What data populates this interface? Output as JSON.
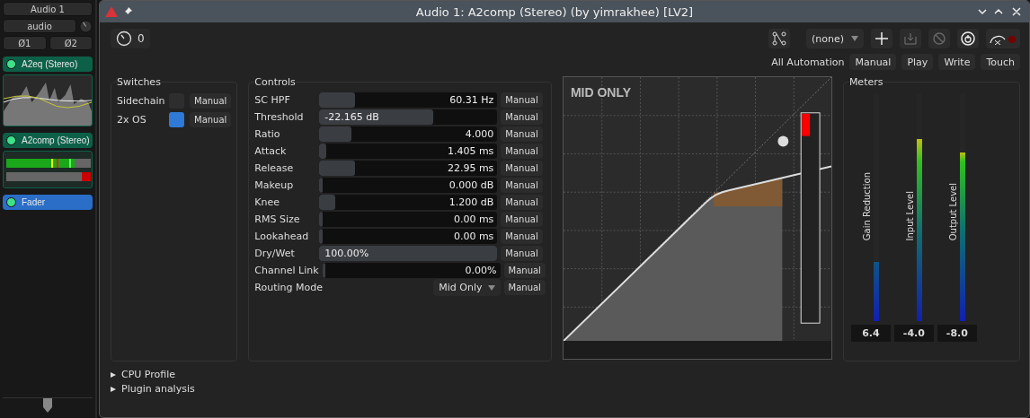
{
  "strip": {
    "track": "Audio 1",
    "input": "audio",
    "phase": [
      "Ø1",
      "Ø2"
    ],
    "plugins": [
      {
        "name": "A2eq (Stereo)",
        "kind": "eq",
        "on": true
      },
      {
        "name": "A2comp (Stereo)",
        "kind": "comp",
        "on": true
      },
      {
        "name": "Fader",
        "kind": "fader",
        "on": true
      }
    ]
  },
  "window": {
    "title": "Audio 1: A2comp (Stereo) (by yimrakhee) [LV2]"
  },
  "toolbar": {
    "counter": "0",
    "preset": "(none)",
    "automation_label": "All Automation",
    "automation_buttons": [
      "Manual",
      "Play",
      "Write",
      "Touch"
    ]
  },
  "switches": {
    "title": "Switches",
    "items": [
      {
        "label": "Sidechain",
        "on": false,
        "mode": "Manual"
      },
      {
        "label": "2x OS",
        "on": true,
        "mode": "Manual"
      }
    ]
  },
  "controls": {
    "title": "Controls",
    "items": [
      {
        "kind": "slider",
        "label": "SC HPF",
        "value": "60.31 Hz",
        "level": 0.2,
        "mode": "Manual"
      },
      {
        "kind": "slider",
        "label": "Threshold",
        "value": "-22.165 dB",
        "level": 0.64,
        "mode": "Manual"
      },
      {
        "kind": "slider",
        "label": "Ratio",
        "value": "4.000",
        "level": 0.18,
        "mode": "Manual"
      },
      {
        "kind": "slider",
        "label": "Attack",
        "value": "1.405 ms",
        "level": 0.04,
        "mode": "Manual"
      },
      {
        "kind": "slider",
        "label": "Release",
        "value": "22.95 ms",
        "level": 0.2,
        "mode": "Manual"
      },
      {
        "kind": "slider",
        "label": "Makeup",
        "value": "0.000 dB",
        "level": 0.02,
        "mode": "Manual"
      },
      {
        "kind": "slider",
        "label": "Knee",
        "value": "1.200 dB",
        "level": 0.09,
        "mode": "Manual"
      },
      {
        "kind": "slider",
        "label": "RMS Size",
        "value": "0.00 ms",
        "level": 0.02,
        "mode": "Manual"
      },
      {
        "kind": "slider",
        "label": "Lookahead",
        "value": "0.00 ms",
        "level": 0.02,
        "mode": "Manual"
      },
      {
        "kind": "slider",
        "label": "Dry/Wet",
        "value": "100.00%",
        "level": 1,
        "mode": "Manual"
      },
      {
        "kind": "slider",
        "label": "Channel Link",
        "value": "0.00%",
        "level": 0.02,
        "mode": "Manual"
      },
      {
        "kind": "dropdown",
        "label": "Routing Mode",
        "value": "Mid Only",
        "mode": "Manual"
      }
    ]
  },
  "graph": {
    "label": "MID ONLY"
  },
  "meters": {
    "title": "Meters",
    "items": [
      {
        "label": "Gain Reduction",
        "level": 0.26,
        "reading": "6.4"
      },
      {
        "label": "Input Level",
        "level": 0.8,
        "reading": "-4.0"
      },
      {
        "label": "Output Level",
        "level": 0.74,
        "reading": "-8.0"
      }
    ]
  },
  "sections": [
    {
      "label": "CPU Profile",
      "expanded": false
    },
    {
      "label": "Plugin analysis",
      "expanded": false
    }
  ]
}
